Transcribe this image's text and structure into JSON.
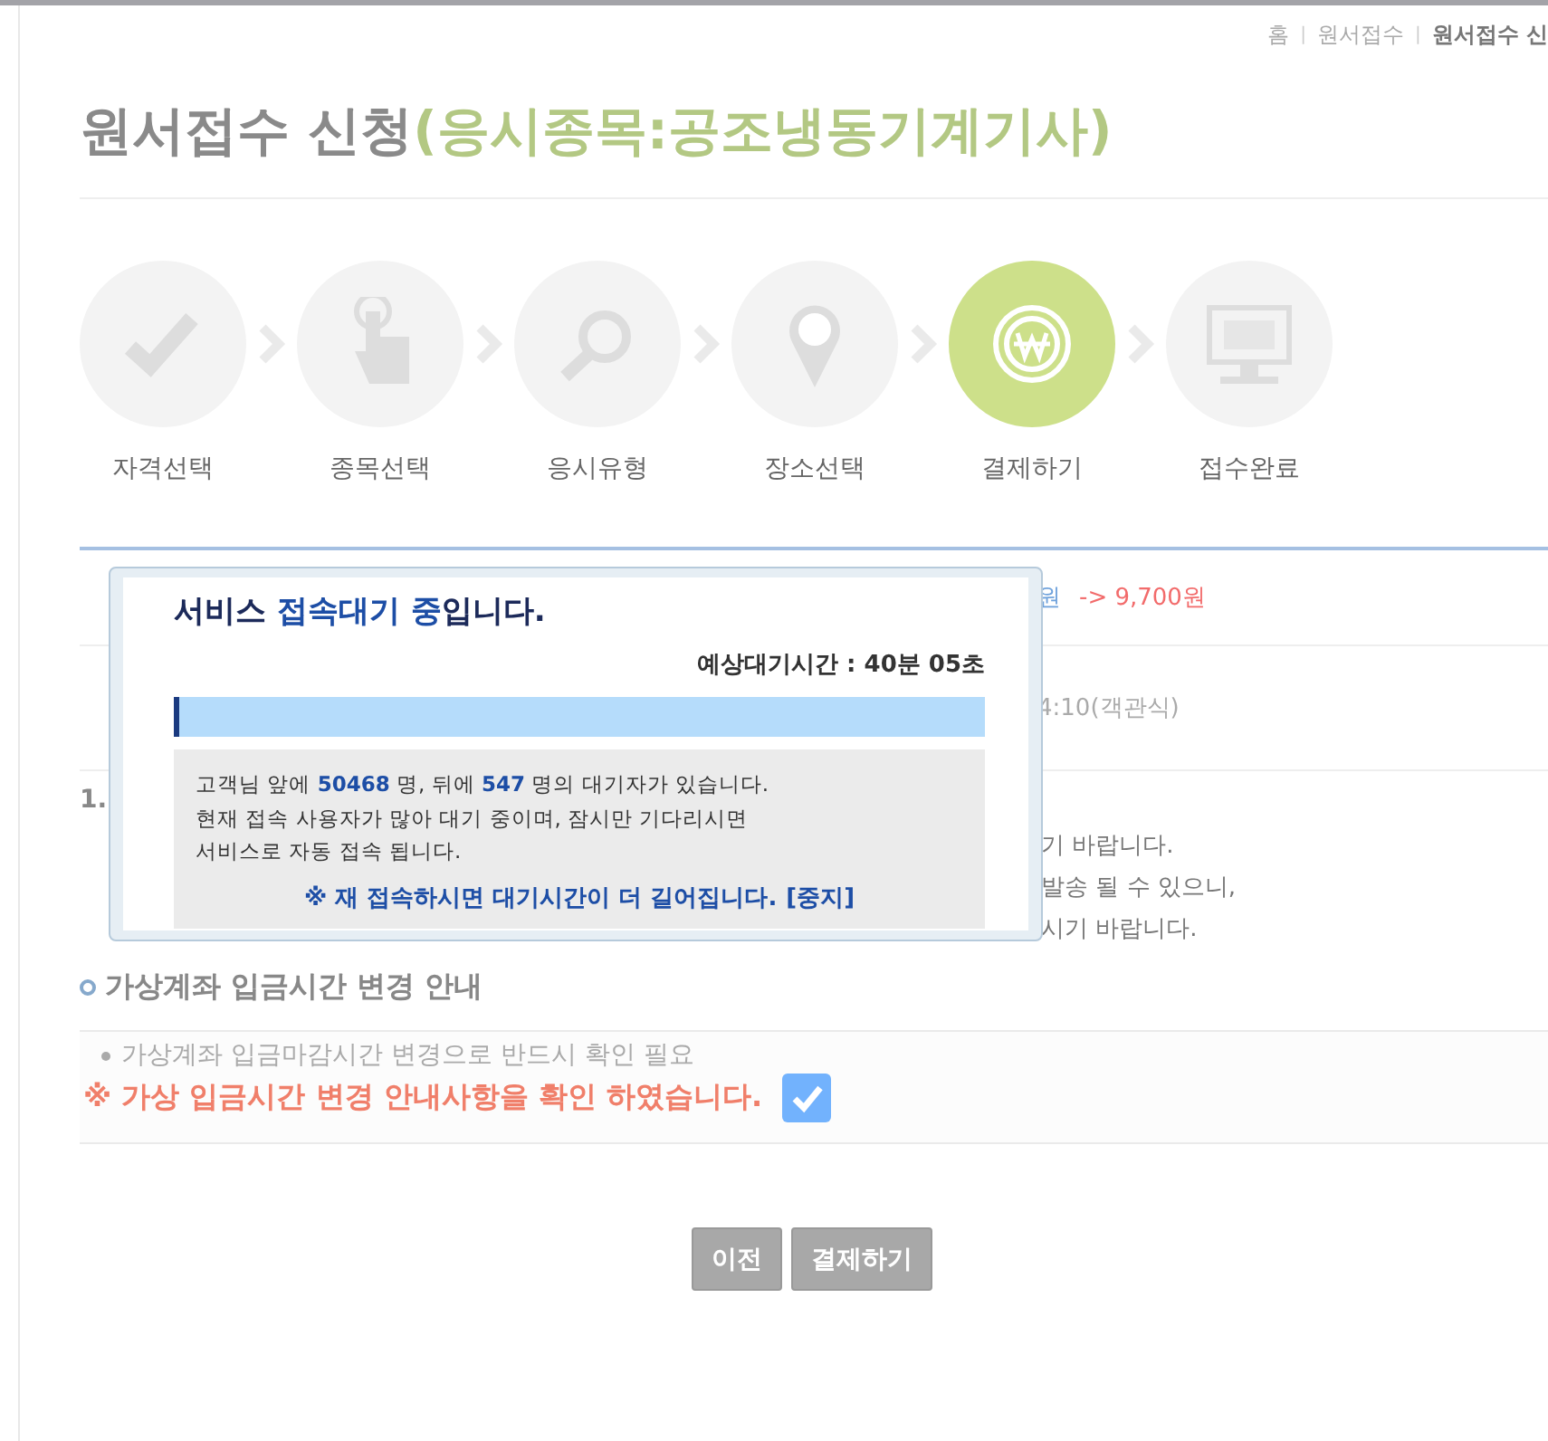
{
  "breadcrumb": {
    "separator": "|",
    "items": [
      {
        "text": "홈",
        "current": false
      },
      {
        "text": "원서접수",
        "current": false
      },
      {
        "text": "원서접수 신",
        "current": true
      }
    ]
  },
  "title": {
    "main": "원서접수 신청",
    "subject": "(응시종목:공조냉동기계기사)"
  },
  "steps": [
    {
      "label": "자격선택",
      "kind": "check",
      "selected": false
    },
    {
      "label": "종목선택",
      "kind": "pointer",
      "selected": false
    },
    {
      "label": "응시유형",
      "kind": "search",
      "selected": false
    },
    {
      "label": "장소선택",
      "kind": "pin",
      "selected": false
    },
    {
      "label": "결제하기",
      "kind": "won",
      "selected": true
    },
    {
      "label": "접수완료",
      "kind": "monitor",
      "selected": false
    }
  ],
  "fee_row": {
    "old": "원",
    "new": "-> 9,700원"
  },
  "time_row": {
    "text": "4:10(객관식)"
  },
  "notice": {
    "number": "1.",
    "lines": [
      "기 바랍니다.",
      "발송 될 수 있으니,",
      "시기 바랍니다."
    ]
  },
  "section": {
    "title": "가상계좌 입금시간 변경 안내",
    "bullet": "가상계좌 입금마감시간 변경으로 반드시 확인 필요",
    "confirm": "※ 가상 입금시간 변경 안내사항을 확인 하였습니다.",
    "checked": true
  },
  "buttons": [
    {
      "label": "이전"
    },
    {
      "label": "결제하기"
    }
  ],
  "modal": {
    "title_parts": [
      {
        "text": "서비스 ",
        "emphasis": false
      },
      {
        "text": "접속대기 중",
        "emphasis": true
      },
      {
        "text": "입니다.",
        "emphasis": false
      }
    ],
    "wait_time": "예상대기시간 : 40분 05초",
    "level": 0.006,
    "lines": [
      "고객님 앞에 **50468** 명, 뒤에 **547** 명의 대기자가 있습니다.",
      "현재 접속 사용자가 많아 대기 중이며, 잠시만 기다리시면",
      "서비스로 자동 접속 됩니다."
    ],
    "warning": "※ 재 접속하시면 대기시간이 더 길어집니다.",
    "stop_link": "[중지]"
  }
}
